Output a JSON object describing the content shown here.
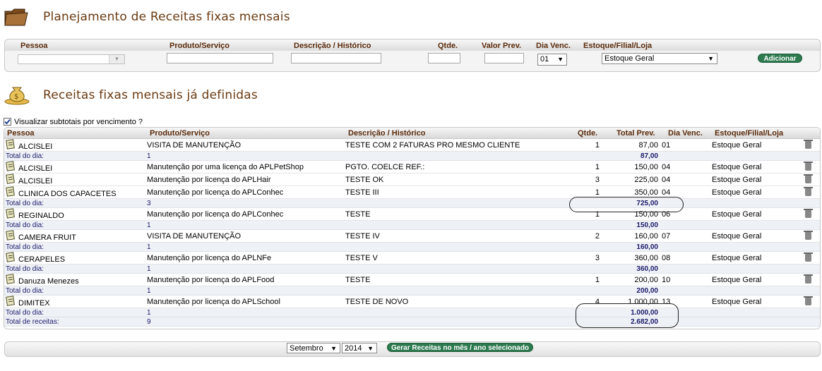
{
  "header": {
    "title": "Planejamento de Receitas fixas mensais",
    "subtitle": "Receitas fixas mensais já definidas"
  },
  "form": {
    "labels": {
      "pessoa": "Pessoa",
      "produto": "Produto/Serviço",
      "descricao": "Descrição / Histórico",
      "qtde": "Qtde.",
      "valor": "Valor Prev.",
      "dia": "Dia Venc.",
      "estoque": "Estoque/Filial/Loja"
    },
    "dia_value": "01",
    "estoque_value": "Estoque Geral",
    "add_label": "Adicionar"
  },
  "checkbox": {
    "label": "Visualizar subtotais por vencimento ?",
    "checked": true
  },
  "table": {
    "headers": {
      "pessoa": "Pessoa",
      "produto": "Produto/Serviço",
      "descricao": "Descrição / Histórico",
      "qtde": "Qtde.",
      "total": "Total Prev.",
      "dia": "Dia Venc.",
      "estoque": "Estoque/Filial/Loja"
    },
    "total_label": "Total do dia:",
    "grand_label": "Total de receitas:",
    "rows": [
      {
        "type": "item",
        "pessoa": "ALCISLEI",
        "produto": "VISITA DE MANUTENÇÃO",
        "descricao": "TESTE COM 2 FATURAS PRO MESMO CLIENTE",
        "qtde": "1",
        "total": "87,00",
        "dia": "01",
        "estoque": "Estoque Geral"
      },
      {
        "type": "total",
        "count": "1",
        "total": "87,00"
      },
      {
        "type": "item",
        "pessoa": "ALCISLEI",
        "produto": "Manutenção por uma licença do APLPetShop",
        "descricao": "PGTO. COELCE REF.:",
        "qtde": "1",
        "total": "150,00",
        "dia": "04",
        "estoque": "Estoque Geral"
      },
      {
        "type": "item",
        "pessoa": "ALCISLEI",
        "produto": "Manutenção por licença do APLHair",
        "descricao": "TESTE OK",
        "qtde": "3",
        "total": "225,00",
        "dia": "04",
        "estoque": "Estoque Geral"
      },
      {
        "type": "item",
        "pessoa": "CLINICA DOS CAPACETES",
        "produto": "Manutenção por licença do APLConhec",
        "descricao": "TESTE III",
        "qtde": "1",
        "total": "350,00",
        "dia": "04",
        "estoque": "Estoque Geral"
      },
      {
        "type": "total",
        "count": "3",
        "total": "725,00"
      },
      {
        "type": "item",
        "pessoa": "REGINALDO",
        "produto": "Manutenção por licença do APLConhec",
        "descricao": "TESTE",
        "qtde": "1",
        "total": "150,00",
        "dia": "06",
        "estoque": "Estoque Geral"
      },
      {
        "type": "total",
        "count": "1",
        "total": "150,00"
      },
      {
        "type": "item",
        "pessoa": "CAMERA FRUIT",
        "produto": "VISITA DE MANUTENÇÃO",
        "descricao": "TESTE IV",
        "qtde": "2",
        "total": "160,00",
        "dia": "07",
        "estoque": "Estoque Geral"
      },
      {
        "type": "total",
        "count": "1",
        "total": "160,00"
      },
      {
        "type": "item",
        "pessoa": "CERAPELES",
        "produto": "Manutenção por licença do APLNFe",
        "descricao": "TESTE V",
        "qtde": "3",
        "total": "360,00",
        "dia": "08",
        "estoque": "Estoque Geral"
      },
      {
        "type": "total",
        "count": "1",
        "total": "360,00"
      },
      {
        "type": "item",
        "pessoa": "Danuza Menezes",
        "produto": "Manutenção por licença do APLFood",
        "descricao": "TESTE",
        "qtde": "1",
        "total": "200,00",
        "dia": "10",
        "estoque": "Estoque Geral"
      },
      {
        "type": "total",
        "count": "1",
        "total": "200,00"
      },
      {
        "type": "item",
        "pessoa": "DIMITEX",
        "produto": "Manutenção por licença do APLSchool",
        "descricao": "TESTE DE NOVO",
        "qtde": "4",
        "total": "1.000,00",
        "dia": "13",
        "estoque": "Estoque Geral"
      },
      {
        "type": "total",
        "count": "1",
        "total": "1.000,00"
      },
      {
        "type": "grand",
        "count": "9",
        "total": "2.682,00"
      }
    ]
  },
  "footer": {
    "month": "Setembro",
    "year": "2014",
    "generate_label": "Gerar Receitas no mês / ano selecionado"
  },
  "colors": {
    "title": "#6a3a12",
    "header_label": "#5a2a0a",
    "button_green": "#2d7a4f",
    "total_text": "#1a1a6a"
  }
}
